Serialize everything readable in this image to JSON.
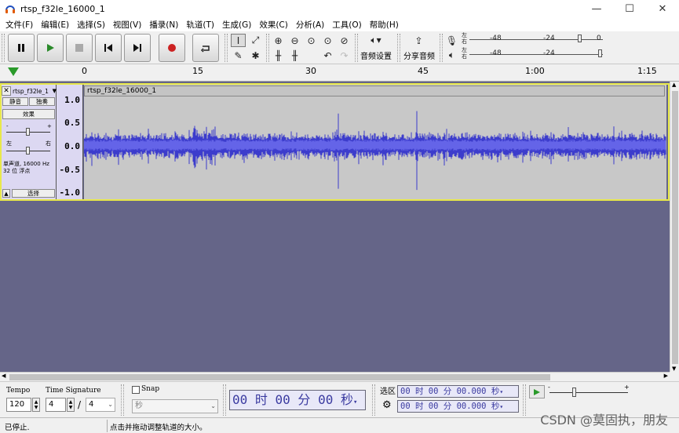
{
  "window": {
    "title": "rtsp_f32le_16000_1",
    "minimize": "—",
    "maximize": "☐",
    "close": "✕"
  },
  "menu": [
    "文件(F)",
    "编辑(E)",
    "选择(S)",
    "视图(V)",
    "播录(N)",
    "轨道(T)",
    "生成(G)",
    "效果(C)",
    "分析(A)",
    "工具(O)",
    "帮助(H)"
  ],
  "toolbar": {
    "audio_setup_label": "音频设置",
    "share_audio_label": "分享音频",
    "record_meter_scale": [
      "-48",
      "-24",
      "0"
    ],
    "play_meter_scale": [
      "-48",
      "-24"
    ]
  },
  "ruler": {
    "ticks": [
      "0",
      "15",
      "30",
      "45",
      "1:00",
      "1:15"
    ]
  },
  "track": {
    "name": "rtsp_f32le_1",
    "clip_name": "rtsp_f32le_16000_1",
    "mute_label": "静音",
    "solo_label": "独奏",
    "effects_label": "效果",
    "pan_left": "左",
    "pan_right": "右",
    "gain_minus": "-",
    "gain_plus": "+",
    "info_line1": "单声道, 16000 Hz",
    "info_line2": "32 位 浮点",
    "select_label": "选择",
    "vscale": [
      "1.0",
      "0.5",
      "0.0",
      "-0.5",
      "-1.0"
    ]
  },
  "bottom": {
    "tempo_label": "Tempo",
    "tempo_value": "120",
    "time_sig_label": "Time Signature",
    "time_sig_num": "4",
    "time_sig_slash": "/",
    "time_sig_den": "4",
    "snap_label": "Snap",
    "snap_unit": "秒",
    "big_time": "00 时 00 分 00 秒",
    "selection_label": "选区",
    "sel_start": "00 时 00 分 00.000 秒",
    "sel_end": "00 时 00 分 00.000 秒"
  },
  "status": {
    "state": "已停止.",
    "hint": "点击并拖动调整轨道的大小。"
  },
  "watermark": "CSDN @莫固执，朋友",
  "colors": {
    "track_bg": "#656588",
    "waveform": "#3c3ccc",
    "wave_bg": "#c8c8c8",
    "record_red": "#cc2222",
    "play_green": "#2a9a2a",
    "selected_border": "#e8e84a"
  }
}
